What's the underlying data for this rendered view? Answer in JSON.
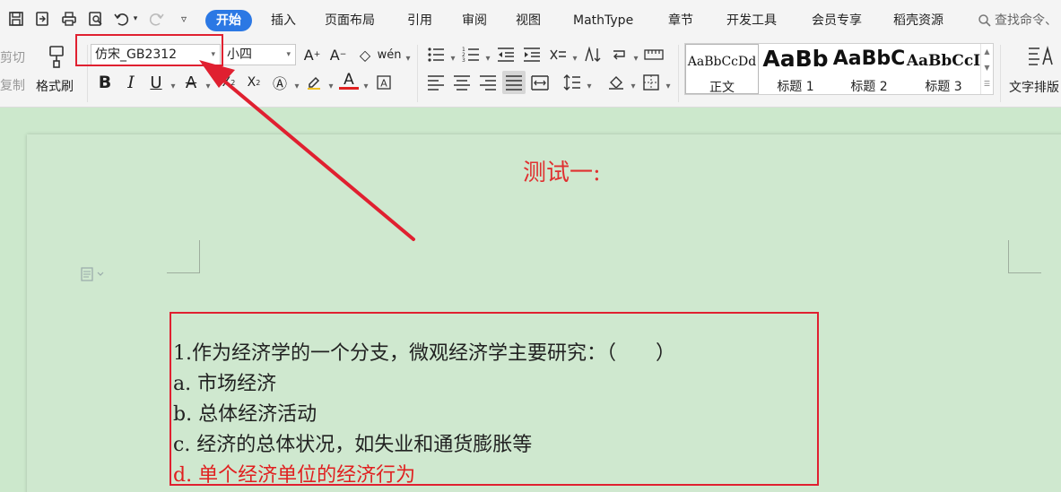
{
  "menubar": {
    "quick_access": [
      {
        "name": "save-icon",
        "glyph": "⌂"
      },
      {
        "name": "export-icon",
        "glyph": "⎘"
      },
      {
        "name": "print-icon",
        "glyph": "⎙"
      },
      {
        "name": "print-preview-icon",
        "glyph": "⌕"
      },
      {
        "name": "undo-icon",
        "glyph": "↶"
      },
      {
        "name": "redo-icon",
        "glyph": "↷"
      },
      {
        "name": "more-icon",
        "glyph": "▿"
      }
    ],
    "tabs": [
      "开始",
      "插入",
      "页面布局",
      "引用",
      "审阅",
      "视图",
      "MathType",
      "章节",
      "开发工具",
      "会员专享",
      "稻壳资源"
    ],
    "active_tab": "开始",
    "search_placeholder": "查找命令、"
  },
  "ribbon": {
    "clipboard": {
      "cut": "剪切",
      "copy": "复制",
      "format_painter": "格式刷"
    },
    "font": {
      "family": "仿宋_GB2312",
      "size": "小四"
    },
    "styles": [
      {
        "preview": "AaBbCcDd",
        "label": "正文"
      },
      {
        "preview": "AaBb",
        "label": "标题 1"
      },
      {
        "preview": "AaBbC",
        "label": "标题 2"
      },
      {
        "preview": "AaBbCcI",
        "label": "标题 3"
      }
    ],
    "text_layout": "文字排版"
  },
  "document": {
    "title": "测试一:",
    "question": "1.作为经济学的一个分支，微观经济学主要研究：（　　）",
    "options": [
      {
        "text": "a.  市场经济",
        "correct": false
      },
      {
        "text": "b.  总体经济活动",
        "correct": false
      },
      {
        "text": "c.  经济的总体状况，如失业和通货膨胀等",
        "correct": false
      },
      {
        "text": "d.  单个经济单位的经济行为",
        "correct": true
      }
    ]
  },
  "colors": {
    "accent": "#2b78e4",
    "page_background": "#cce8cc",
    "annotation_red": "#e02030",
    "correct_answer": "#e02020"
  }
}
